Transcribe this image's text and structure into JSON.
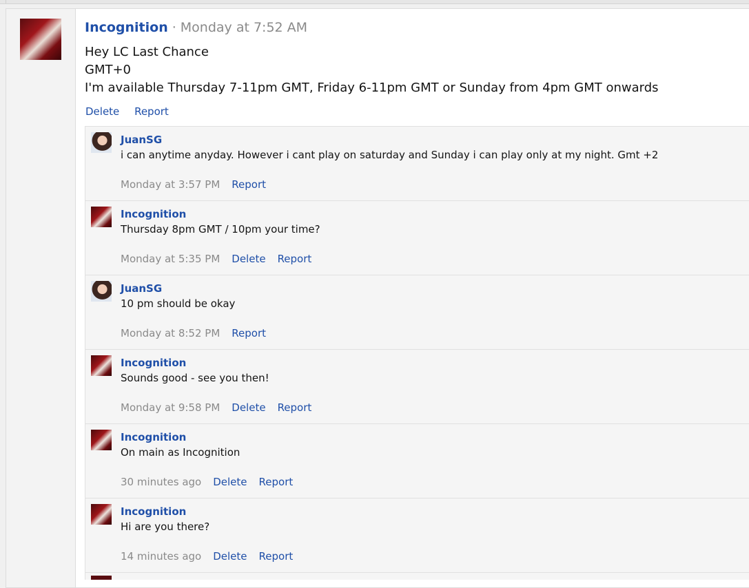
{
  "post": {
    "author": "Incognition",
    "separator": "·",
    "timestamp": "Monday at 7:52 AM",
    "body": [
      "Hey LC Last Chance",
      "GMT+0",
      "I'm available Thursday 7-11pm GMT, Friday 6-11pm GMT or Sunday from 4pm GMT onwards"
    ],
    "actions": {
      "delete": "Delete",
      "report": "Report"
    }
  },
  "comments": [
    {
      "author": "JuanSG",
      "text": "i can anytime anyday. However i cant play on saturday and Sunday i can play only at my night. Gmt +2",
      "time": "Monday at 3:57 PM",
      "delete": "",
      "report": "Report",
      "avatar": "juan"
    },
    {
      "author": "Incognition",
      "text": "Thursday 8pm GMT / 10pm your time?",
      "time": "Monday at 5:35 PM",
      "delete": "Delete",
      "report": "Report",
      "avatar": "inc"
    },
    {
      "author": "JuanSG",
      "text": "10 pm should be okay",
      "time": "Monday at 8:52 PM",
      "delete": "",
      "report": "Report",
      "avatar": "juan"
    },
    {
      "author": "Incognition",
      "text": "Sounds good - see you then!",
      "time": "Monday at 9:58 PM",
      "delete": "Delete",
      "report": "Report",
      "avatar": "inc"
    },
    {
      "author": "Incognition",
      "text": "On main as Incognition",
      "time": "30 minutes ago",
      "delete": "Delete",
      "report": "Report",
      "avatar": "inc"
    },
    {
      "author": "Incognition",
      "text": "Hi are you there?",
      "time": "14 minutes ago",
      "delete": "Delete",
      "report": "Report",
      "avatar": "inc"
    }
  ]
}
